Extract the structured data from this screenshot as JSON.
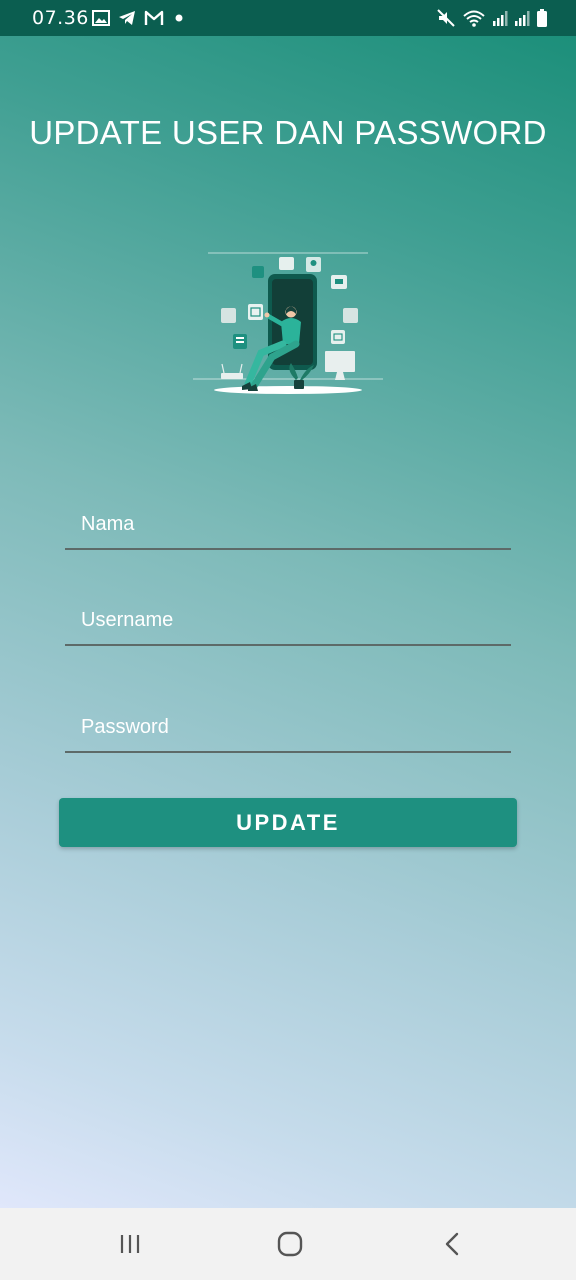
{
  "status_bar": {
    "time": "07.36",
    "left_icons": [
      "image-icon",
      "telegram-icon",
      "gmail-icon",
      "dot-icon"
    ],
    "right_icons": [
      "mute-icon",
      "wifi-icon",
      "signal-icon",
      "signal-icon",
      "battery-icon"
    ]
  },
  "page": {
    "title": "UPDATE USER DAN PASSWORD",
    "illustration": "phone-user-illustration"
  },
  "form": {
    "nama": {
      "placeholder": "Nama",
      "value": ""
    },
    "username": {
      "placeholder": "Username",
      "value": ""
    },
    "password": {
      "placeholder": "Password",
      "value": ""
    },
    "submit_label": "UPDATE"
  },
  "colors": {
    "accent": "#1e9080",
    "status_bar": "#0b5e50",
    "underline": "#5d6a68",
    "nav_bar": "#f2f2f2"
  },
  "nav_bar": {
    "buttons": [
      "recents-icon",
      "home-icon",
      "back-icon"
    ]
  }
}
